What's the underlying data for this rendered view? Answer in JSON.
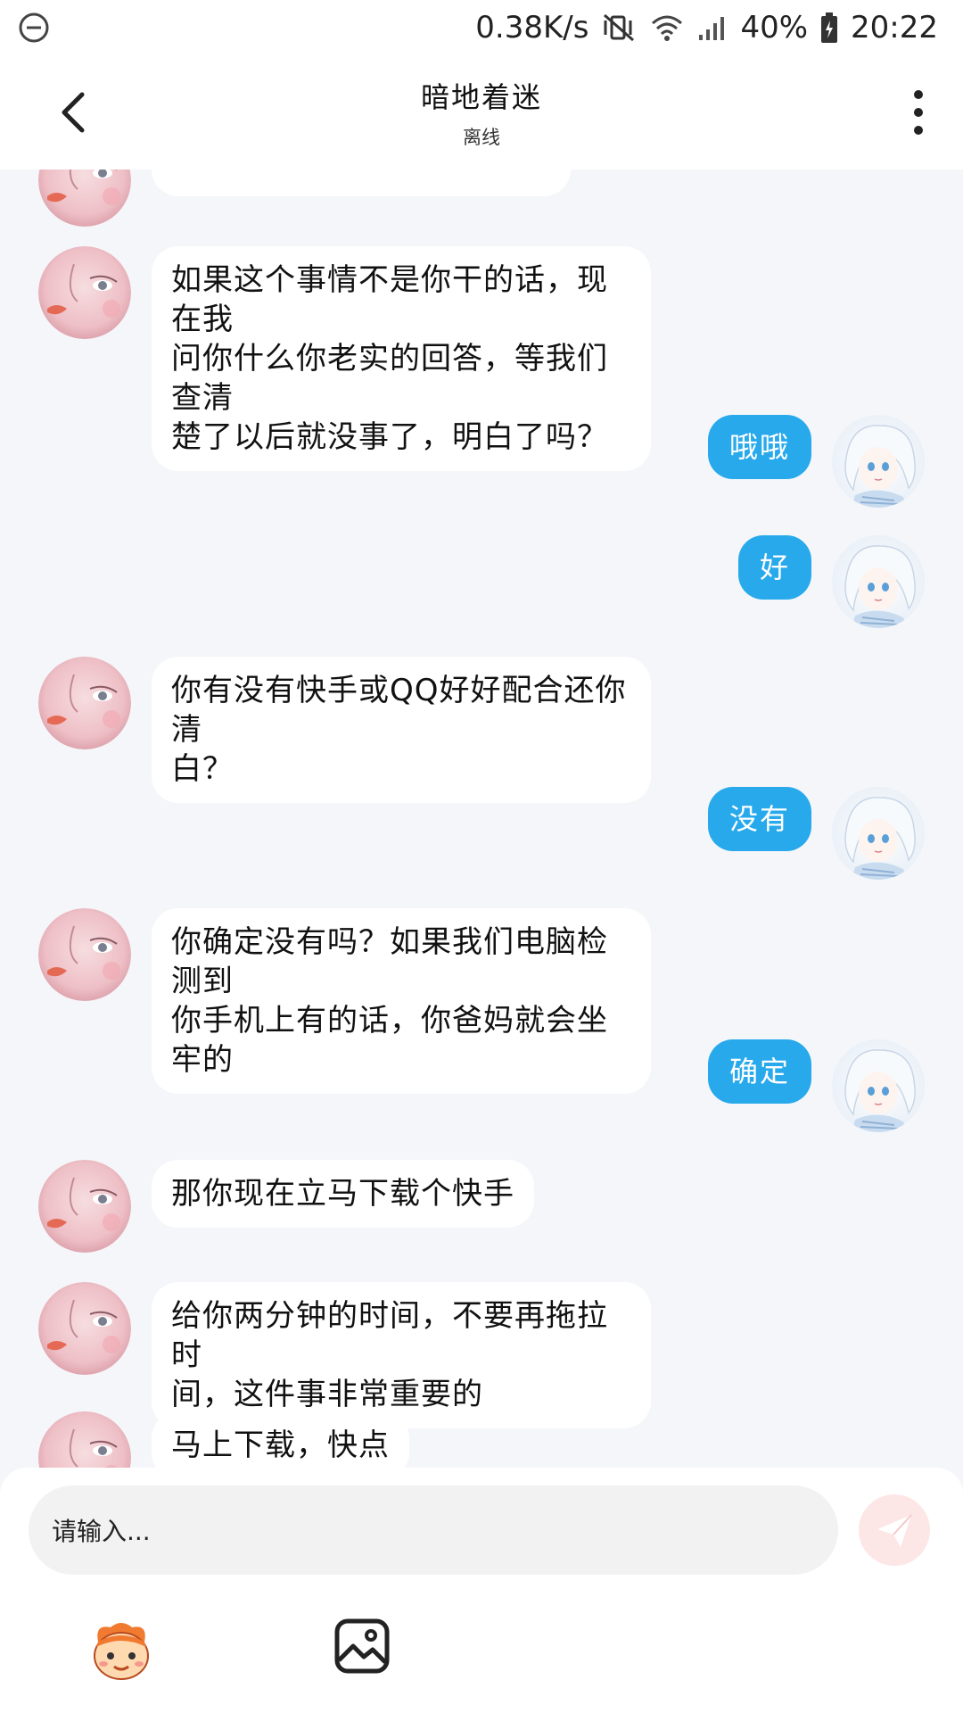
{
  "status_bar": {
    "net_speed": "0.38K/s",
    "battery": "40%",
    "time": "20:22",
    "icons": [
      "dnd-icon",
      "mute-vibrate-icon",
      "wifi-icon",
      "signal-icon",
      "battery-icon"
    ]
  },
  "header": {
    "title": "暗地着迷",
    "status": "离线",
    "back_icon": "back-chevron-icon",
    "more_icon": "more-vertical-icon"
  },
  "messages": [
    {
      "side": "left",
      "lines": [
        "如果这个事情不是你干的话，现在我",
        "问你什么你老实的回答，等我们查清",
        "楚了以后就没事了，明白了吗？"
      ]
    },
    {
      "side": "right",
      "lines": [
        "哦哦"
      ]
    },
    {
      "side": "right",
      "lines": [
        "好"
      ]
    },
    {
      "side": "left",
      "lines": [
        "你有没有快手或QQ好好配合还你清",
        "白？"
      ]
    },
    {
      "side": "right",
      "lines": [
        "没有"
      ]
    },
    {
      "side": "left",
      "lines": [
        "你确定没有吗？如果我们电脑检测到",
        "你手机上有的话，你爸妈就会坐牢的"
      ]
    },
    {
      "side": "right",
      "lines": [
        "确定"
      ]
    },
    {
      "side": "left",
      "lines": [
        "那你现在立马下载个快手"
      ]
    },
    {
      "side": "left",
      "lines": [
        "给你两分钟的时间，不要再拖拉时",
        "间，这件事非常重要的"
      ]
    },
    {
      "side": "left",
      "lines": [
        "马上下载，快点"
      ]
    }
  ],
  "input": {
    "placeholder": "请输入...",
    "send_icon": "send-paper-plane-icon",
    "emoji_icon": "emoji-face-icon",
    "image_icon": "image-icon"
  },
  "colors": {
    "accent_bubble": "#27a9ec",
    "background": "#f4f6fa",
    "send_button_bg": "#fde6e6"
  }
}
